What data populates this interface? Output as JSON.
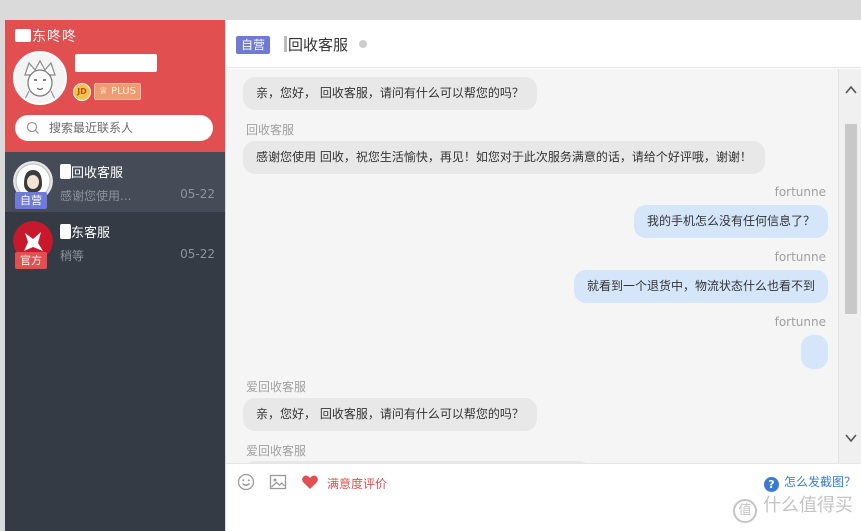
{
  "sidebar": {
    "app_title": "东咚咚",
    "plus_label": "PLUS",
    "vip_level": "JD",
    "search": {
      "placeholder": "搜索最近联系人"
    },
    "contacts": [
      {
        "tag": "自营",
        "name": "回收客服",
        "preview": "感谢您使用...",
        "date": "05-22",
        "tag_color": "#6e79d8",
        "active": true
      },
      {
        "tag": "官方",
        "name": "东客服",
        "preview": "稍等",
        "date": "05-22",
        "tag_color": "#e24f50",
        "active": false
      }
    ]
  },
  "chat": {
    "header": {
      "tag": "自营",
      "title": "回收客服"
    },
    "messages": [
      {
        "side": "left",
        "sender": "",
        "text": "亲，您好，  回收客服，请问有什么可以帮您的吗？"
      },
      {
        "side": "left",
        "sender": "回收客服",
        "text": "感谢您使用  回收，祝您生活愉快，再见！如您对于此次服务满意的话，请给个好评哦，谢谢！"
      },
      {
        "side": "right",
        "sender": "fortunne",
        "text": "我的手机怎么没有任何信息了？"
      },
      {
        "side": "right",
        "sender": "fortunne",
        "text": "就看到一个退货中，物流状态什么也看不到"
      },
      {
        "side": "right",
        "sender": "fortunne",
        "text": ""
      },
      {
        "side": "left",
        "sender": "爱回收客服",
        "text": "亲，您好，  回收客服，请问有什么可以帮您的吗？"
      },
      {
        "side": "left",
        "sender": "爱回收客服",
        "text": ""
      }
    ],
    "toolbar": {
      "rating_label": "满意度评价",
      "help_label": "怎么发截图？"
    }
  },
  "watermark": {
    "logo": "值",
    "text": "什么值得买"
  },
  "colors": {
    "brand_red": "#e24f50",
    "sidebar_dark": "#343b45",
    "self_tag": "#6e79d8",
    "bubble_right": "#d5e6fb",
    "bubble_left": "#e8e8e8",
    "help_blue": "#3a7ad5"
  },
  "icons": [
    "search-icon",
    "emoji-icon",
    "image-icon",
    "heart-icon",
    "question-icon",
    "chevron-up-icon",
    "chevron-down-icon"
  ]
}
